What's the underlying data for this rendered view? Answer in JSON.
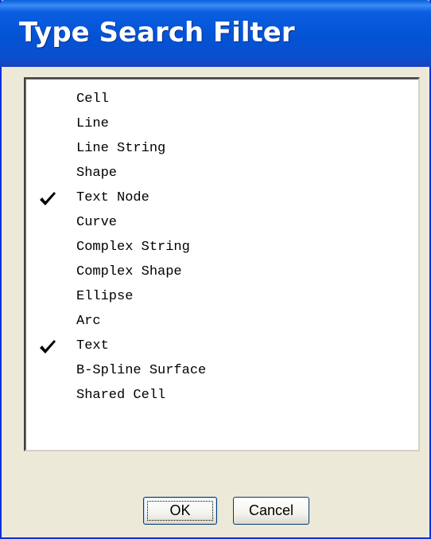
{
  "dialog": {
    "title": "Type Search Filter"
  },
  "list": {
    "items": [
      {
        "label": "Cell",
        "checked": false
      },
      {
        "label": "Line",
        "checked": false
      },
      {
        "label": "Line String",
        "checked": false
      },
      {
        "label": "Shape",
        "checked": false
      },
      {
        "label": "Text Node",
        "checked": true
      },
      {
        "label": "Curve",
        "checked": false
      },
      {
        "label": "Complex String",
        "checked": false
      },
      {
        "label": "Complex Shape",
        "checked": false
      },
      {
        "label": "Ellipse",
        "checked": false
      },
      {
        "label": "Arc",
        "checked": false
      },
      {
        "label": "Text",
        "checked": true
      },
      {
        "label": "B-Spline Surface",
        "checked": false
      },
      {
        "label": "Shared Cell",
        "checked": false
      }
    ],
    "check_icon": "checkmark-icon"
  },
  "buttons": {
    "ok_label": "OK",
    "cancel_label": "Cancel"
  },
  "colors": {
    "titlebar": "#0353d4",
    "window_face": "#ece9d8",
    "list_background": "#ffffff"
  }
}
